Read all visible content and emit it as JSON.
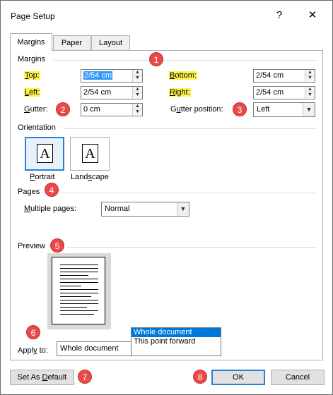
{
  "window": {
    "title": "Page Setup",
    "help": "?",
    "close": "✕"
  },
  "tabs": [
    {
      "label": "Margins",
      "active": true
    },
    {
      "label": "Paper",
      "active": false
    },
    {
      "label": "Layout",
      "active": false
    }
  ],
  "margins": {
    "section": "Margins",
    "top": {
      "label_pre": "",
      "label_u": "T",
      "label_post": "op:",
      "value": "2/54 cm"
    },
    "bottom": {
      "label_pre": "",
      "label_u": "B",
      "label_post": "ottom:",
      "value": "2/54 cm"
    },
    "left": {
      "label_pre": "",
      "label_u": "L",
      "label_post": "eft:",
      "value": "2/54 cm"
    },
    "right": {
      "label_pre": "",
      "label_u": "R",
      "label_post": "ight:",
      "value": "2/54 cm"
    },
    "gutter": {
      "label_pre": "",
      "label_u": "G",
      "label_post": "utter:",
      "value": "0 cm"
    },
    "gutter_position": {
      "label_pre": "G",
      "label_u": "u",
      "label_post": "tter position:",
      "value": "Left"
    }
  },
  "orientation": {
    "section": "Orientation",
    "portrait": {
      "label_pre": "",
      "label_u": "P",
      "label_post": "ortrait",
      "selected": true
    },
    "landscape": {
      "label_pre": "Land",
      "label_u": "s",
      "label_post": "cape",
      "selected": false
    },
    "icon_glyph": "A"
  },
  "pages": {
    "section": "Pages",
    "multiple_pages": {
      "label_pre": "",
      "label_u": "M",
      "label_post": "ultiple pages:",
      "value": "Normal"
    }
  },
  "preview": {
    "section": "Preview"
  },
  "apply_to": {
    "label_pre": "Appl",
    "label_u": "y",
    "label_post": " to:",
    "value": "Whole document",
    "options": [
      "Whole document",
      "This point forward"
    ]
  },
  "buttons": {
    "set_default": {
      "label_pre": "Set As ",
      "label_u": "D",
      "label_post": "efault"
    },
    "ok": "OK",
    "cancel": "Cancel"
  },
  "badges": [
    "1",
    "2",
    "3",
    "4",
    "5",
    "6",
    "7",
    "8"
  ],
  "colors": {
    "highlight": "#fff250",
    "badge": "#e84a4a",
    "selection": "#0078d7",
    "focus_border": "#2a7fd4"
  }
}
